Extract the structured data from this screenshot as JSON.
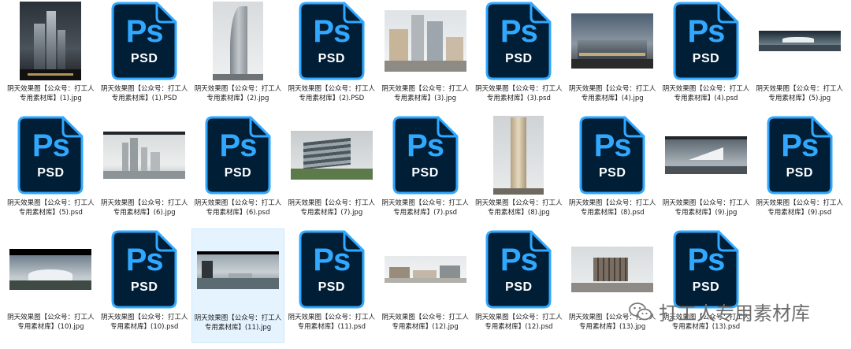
{
  "files": [
    {
      "name": "阴天效果图【公众号：打工人专用素材库】(1).jpg",
      "kind": "jpg",
      "thumb": "night-towers"
    },
    {
      "name": "阴天效果图【公众号：打工人专用素材库】(1).PSD",
      "kind": "psd"
    },
    {
      "name": "阴天效果图【公众号：打工人专用素材库】(2).jpg",
      "kind": "jpg",
      "thumb": "curved-tower"
    },
    {
      "name": "阴天效果图【公众号：打工人专用素材库】(2).PSD",
      "kind": "psd"
    },
    {
      "name": "阴天效果图【公众号：打工人专用素材库】(3).jpg",
      "kind": "jpg",
      "thumb": "street-buildings"
    },
    {
      "name": "阴天效果图【公众号：打工人专用素材库】(3).psd",
      "kind": "psd"
    },
    {
      "name": "阴天效果图【公众号：打工人专用素材库】(4).jpg",
      "kind": "jpg",
      "thumb": "plaza-dusk"
    },
    {
      "name": "阴天效果图【公众号：打工人专用素材库】(4).psd",
      "kind": "psd"
    },
    {
      "name": "阴天效果图【公众号：打工人专用素材库】(5).jpg",
      "kind": "jpg",
      "thumb": "lake-pavilion"
    },
    {
      "name": "阴天效果图【公众号：打工人专用素材库】(5).psd",
      "kind": "psd"
    },
    {
      "name": "阴天效果图【公众号：打工人专用素材库】(6).jpg",
      "kind": "jpg",
      "thumb": "skyline-mist"
    },
    {
      "name": "阴天效果图【公众号：打工人专用素材库】(6).psd",
      "kind": "psd"
    },
    {
      "name": "阴天效果图【公众号：打工人专用素材库】(7).jpg",
      "kind": "jpg",
      "thumb": "glass-office"
    },
    {
      "name": "阴天效果图【公众号：打工人专用素材库】(7).psd",
      "kind": "psd"
    },
    {
      "name": "阴天效果图【公众号：打工人专用素材库】(8).jpg",
      "kind": "jpg",
      "thumb": "tall-tower"
    },
    {
      "name": "阴天效果图【公众号：打工人专用素材库】(8).psd",
      "kind": "psd"
    },
    {
      "name": "阴天效果图【公众号：打工人专用素材库】(9).jpg",
      "kind": "jpg",
      "thumb": "wing-building"
    },
    {
      "name": "阴天效果图【公众号：打工人专用素材库】(9).psd",
      "kind": "psd"
    },
    {
      "name": "阴天效果图【公众号：打工人专用素材库】(10).jpg",
      "kind": "jpg",
      "thumb": "stadium"
    },
    {
      "name": "阴天效果图【公众号：打工人专用素材库】(10).psd",
      "kind": "psd"
    },
    {
      "name": "阴天效果图【公众号：打工人专用素材库】(11).jpg",
      "kind": "jpg",
      "thumb": "waterfront",
      "selected": true
    },
    {
      "name": "阴天效果图【公众号：打工人专用素材库】(11).psd",
      "kind": "psd"
    },
    {
      "name": "阴天效果图【公众号：打工人专用素材库】(12).jpg",
      "kind": "jpg",
      "thumb": "panorama-village"
    },
    {
      "name": "阴天效果图【公众号：打工人专用素材库】(12).psd",
      "kind": "psd"
    },
    {
      "name": "阴天效果图【公众号：打工人专用素材库】(13).jpg",
      "kind": "jpg",
      "thumb": "cube-building"
    },
    {
      "name": "阴天效果图【公众号：打工人专用素材库】(13).psd",
      "kind": "psd"
    }
  ],
  "psd_icon": {
    "top_text": "Ps",
    "bottom_text": "PSD",
    "accent": "#31a8ff",
    "bg": "#001e36"
  },
  "watermark": {
    "text": "打工人专用素材库",
    "icon": "wechat-icon"
  }
}
